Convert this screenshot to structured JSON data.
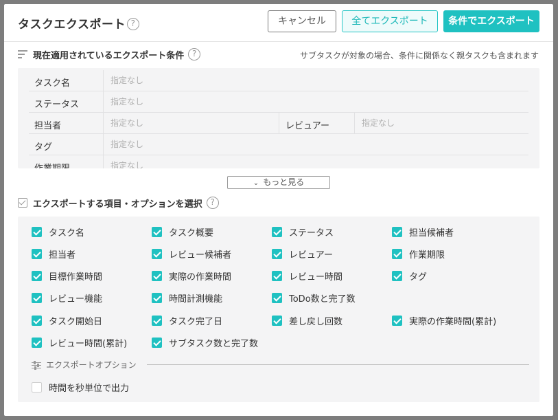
{
  "dialog": {
    "title": "タスクエクスポート",
    "help": "?",
    "buttons": {
      "cancel": "キャンセル",
      "export_all": "全てエクスポート",
      "export_conditions": "条件でエクスポート"
    }
  },
  "conditions": {
    "heading": "現在適用されているエクスポート条件",
    "help": "?",
    "note": "サブタスクが対象の場合、条件に関係なく親タスクも含まれます",
    "rows": [
      {
        "label": "タスク名",
        "value": "指定なし"
      },
      {
        "label": "ステータス",
        "value": "指定なし"
      },
      {
        "label": "担当者",
        "value": "指定なし",
        "label2": "レビュアー",
        "value2": "指定なし"
      },
      {
        "label": "タグ",
        "value": "指定なし"
      },
      {
        "label": "作業期限",
        "value": "指定なし"
      }
    ],
    "more_label": "もっと見る"
  },
  "items": {
    "heading": "エクスポートする項目・オプションを選択",
    "help": "?",
    "options": [
      {
        "label": "タスク名",
        "checked": true
      },
      {
        "label": "タスク概要",
        "checked": true
      },
      {
        "label": "ステータス",
        "checked": true
      },
      {
        "label": "担当候補者",
        "checked": true
      },
      {
        "label": "担当者",
        "checked": true
      },
      {
        "label": "レビュー候補者",
        "checked": true
      },
      {
        "label": "レビュアー",
        "checked": true
      },
      {
        "label": "作業期限",
        "checked": true
      },
      {
        "label": "目標作業時間",
        "checked": true
      },
      {
        "label": "実際の作業時間",
        "checked": true
      },
      {
        "label": "レビュー時間",
        "checked": true
      },
      {
        "label": "タグ",
        "checked": true
      },
      {
        "label": "レビュー機能",
        "checked": true
      },
      {
        "label": "時間計測機能",
        "checked": true
      },
      {
        "label": "ToDo数と完了数",
        "checked": true
      },
      {
        "label": "タスク開始日",
        "checked": true
      },
      {
        "label": "タスク完了日",
        "checked": true
      },
      {
        "label": "差し戻し回数",
        "checked": true
      },
      {
        "label": "実際の作業時間(累計)",
        "checked": true
      },
      {
        "label": "レビュー時間(累計)",
        "checked": true
      },
      {
        "label": "サブタスク数と完了数",
        "checked": true
      }
    ],
    "export_options_heading": "エクスポートオプション",
    "export_options": [
      {
        "label": "時間を秒単位で出力",
        "checked": false
      }
    ]
  }
}
